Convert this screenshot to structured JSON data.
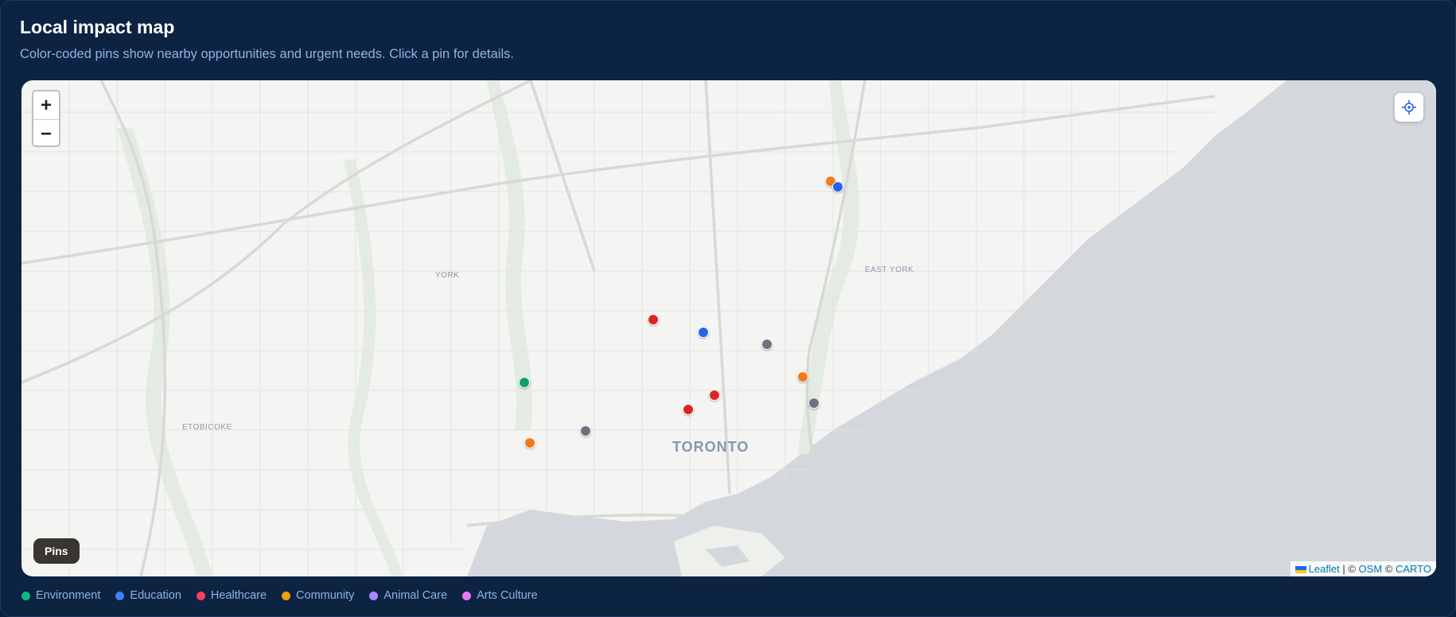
{
  "header": {
    "title": "Local impact map",
    "subtitle": "Color-coded pins show nearby opportunities and urgent needs. Click a pin for details."
  },
  "map": {
    "zoom_in_label": "+",
    "zoom_out_label": "−",
    "pins_button_label": "Pins",
    "attribution": {
      "leaflet": "Leaflet",
      "separator": " | © ",
      "osm": "OSM",
      "copy": " © ",
      "carto": "CARTO"
    },
    "place_labels": {
      "york": "YORK",
      "east_york": "EAST YORK",
      "toronto": "TORONTO",
      "etobicoke": "ETOBICOKE"
    },
    "pins": [
      {
        "category": "community"
      },
      {
        "category": "education"
      },
      {
        "category": "healthcare"
      },
      {
        "category": "education"
      },
      {
        "category": "other"
      },
      {
        "category": "community"
      },
      {
        "category": "environment"
      },
      {
        "category": "healthcare"
      },
      {
        "category": "healthcare"
      },
      {
        "category": "other"
      },
      {
        "category": "other"
      },
      {
        "category": "community"
      }
    ]
  },
  "legend": [
    {
      "label": "Environment",
      "color": "#10b981"
    },
    {
      "label": "Education",
      "color": "#3b82f6"
    },
    {
      "label": "Healthcare",
      "color": "#f43f5e"
    },
    {
      "label": "Community",
      "color": "#f59e0b"
    },
    {
      "label": "Animal Care",
      "color": "#a78bfa"
    },
    {
      "label": "Arts Culture",
      "color": "#e879f9"
    }
  ],
  "pin_colors": {
    "community": "#f07a1a",
    "education": "#2563eb",
    "healthcare": "#dc2626",
    "environment": "#0f9d6e",
    "other": "#6b7280"
  }
}
